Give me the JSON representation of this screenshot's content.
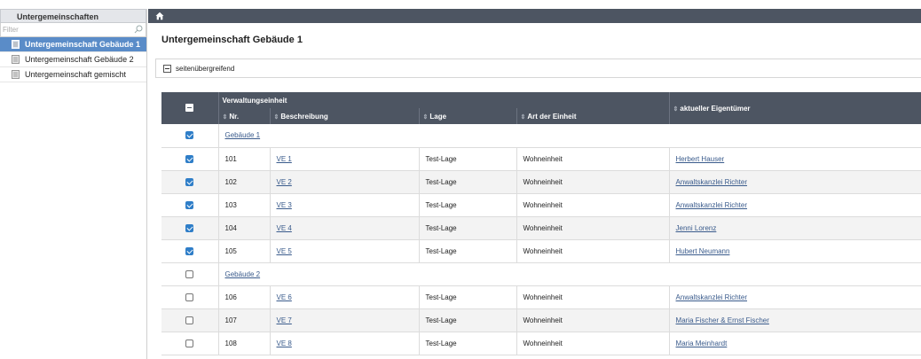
{
  "sidebar": {
    "title": "Untergemeinschaften",
    "filter_placeholder": "Filter",
    "items": [
      {
        "label": "Untergemeinschaft Gebäude 1",
        "active": true
      },
      {
        "label": "Untergemeinschaft Gebäude 2",
        "active": false
      },
      {
        "label": "Untergemeinschaft gemischt",
        "active": false
      }
    ]
  },
  "header": {
    "page_title": "Untergemeinschaft Gebäude 1",
    "cross_page_label": "seitenübergreifend"
  },
  "table": {
    "group_header": "Verwaltungseinheit",
    "columns": {
      "nr": "Nr.",
      "beschreibung": "Beschreibung",
      "lage": "Lage",
      "art": "Art der Einheit",
      "eigentuemer": "aktueller Eigentümer"
    },
    "groups": [
      {
        "label": "Gebäude 1",
        "checked": true
      },
      {
        "label": "Gebäude 2",
        "checked": false
      }
    ],
    "rows": [
      {
        "nr": "101",
        "ve": "VE 1",
        "lage": "Test-Lage",
        "art": "Wohneinheit",
        "owner": "Herbert Hauser",
        "checked": true
      },
      {
        "nr": "102",
        "ve": "VE 2",
        "lage": "Test-Lage",
        "art": "Wohneinheit",
        "owner": "Anwaltskanzlei Richter",
        "checked": true
      },
      {
        "nr": "103",
        "ve": "VE 3",
        "lage": "Test-Lage",
        "art": "Wohneinheit",
        "owner": "Anwaltskanzlei Richter",
        "checked": true
      },
      {
        "nr": "104",
        "ve": "VE 4",
        "lage": "Test-Lage",
        "art": "Wohneinheit",
        "owner": "Jenni Lorenz",
        "checked": true
      },
      {
        "nr": "105",
        "ve": "VE 5",
        "lage": "Test-Lage",
        "art": "Wohneinheit",
        "owner": "Hubert Neumann",
        "checked": true
      },
      {
        "nr": "106",
        "ve": "VE 6",
        "lage": "Test-Lage",
        "art": "Wohneinheit",
        "owner": "Anwaltskanzlei Richter",
        "checked": false
      },
      {
        "nr": "107",
        "ve": "VE 7",
        "lage": "Test-Lage",
        "art": "Wohneinheit",
        "owner": "Maria Fischer & Ernst Fischer",
        "checked": false
      },
      {
        "nr": "108",
        "ve": "VE 8",
        "lage": "Test-Lage",
        "art": "Wohneinheit",
        "owner": "Maria Meinhardt",
        "checked": false
      }
    ]
  },
  "colors": {
    "header_bg": "#4d5562",
    "sidebar_active": "#5a8cc8",
    "checkbox_on": "#2f7ec8",
    "link": "#3a5b8c"
  }
}
